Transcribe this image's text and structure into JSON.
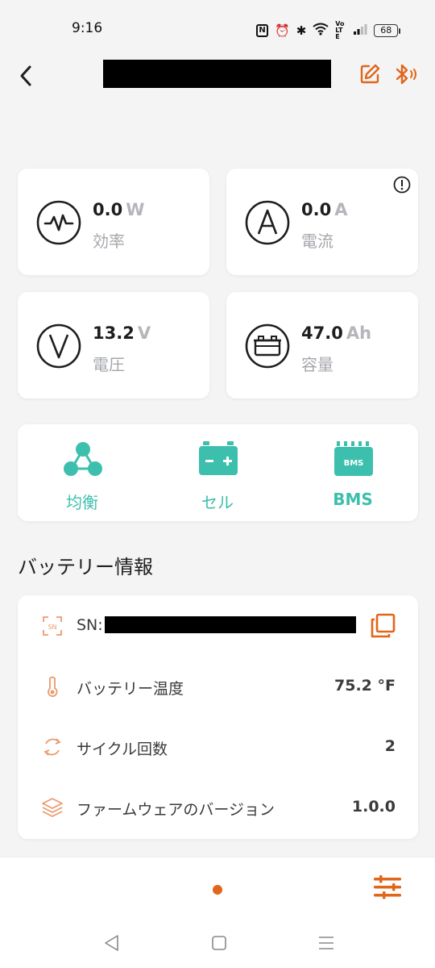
{
  "status_bar": {
    "time": "9:16",
    "battery_level": "68",
    "network": "VoLTE"
  },
  "metrics": [
    {
      "value": "0.0",
      "unit": "W",
      "label": "効率",
      "icon": "pulse-icon"
    },
    {
      "value": "0.0",
      "unit": "A",
      "label": "電流",
      "icon": "ampere-icon"
    },
    {
      "value": "13.2",
      "unit": "V",
      "label": "電圧",
      "icon": "volt-icon"
    },
    {
      "value": "47.0",
      "unit": "Ah",
      "label": "容量",
      "icon": "battery-capacity-icon"
    }
  ],
  "tools": [
    {
      "label": "均衡",
      "icon": "balance-nodes-icon"
    },
    {
      "label": "セル",
      "icon": "cell-battery-icon"
    },
    {
      "label": "BMS",
      "icon": "bms-icon",
      "icon_text": "BMS"
    }
  ],
  "battery_info": {
    "title": "バッテリー情報",
    "sn_label": "SN:",
    "sn_icon_text": "SN",
    "rows": [
      {
        "label": "バッテリー温度",
        "value": "75.2 °F",
        "icon": "thermometer-icon"
      },
      {
        "label": "サイクル回数",
        "value": "2",
        "icon": "cycle-icon"
      },
      {
        "label": "ファームウェアのバージョン",
        "value": "1.0.0",
        "icon": "layers-icon"
      }
    ]
  },
  "colors": {
    "accent_orange": "#e0661a",
    "teal": "#3dbfad",
    "background": "#f4f4f5"
  }
}
